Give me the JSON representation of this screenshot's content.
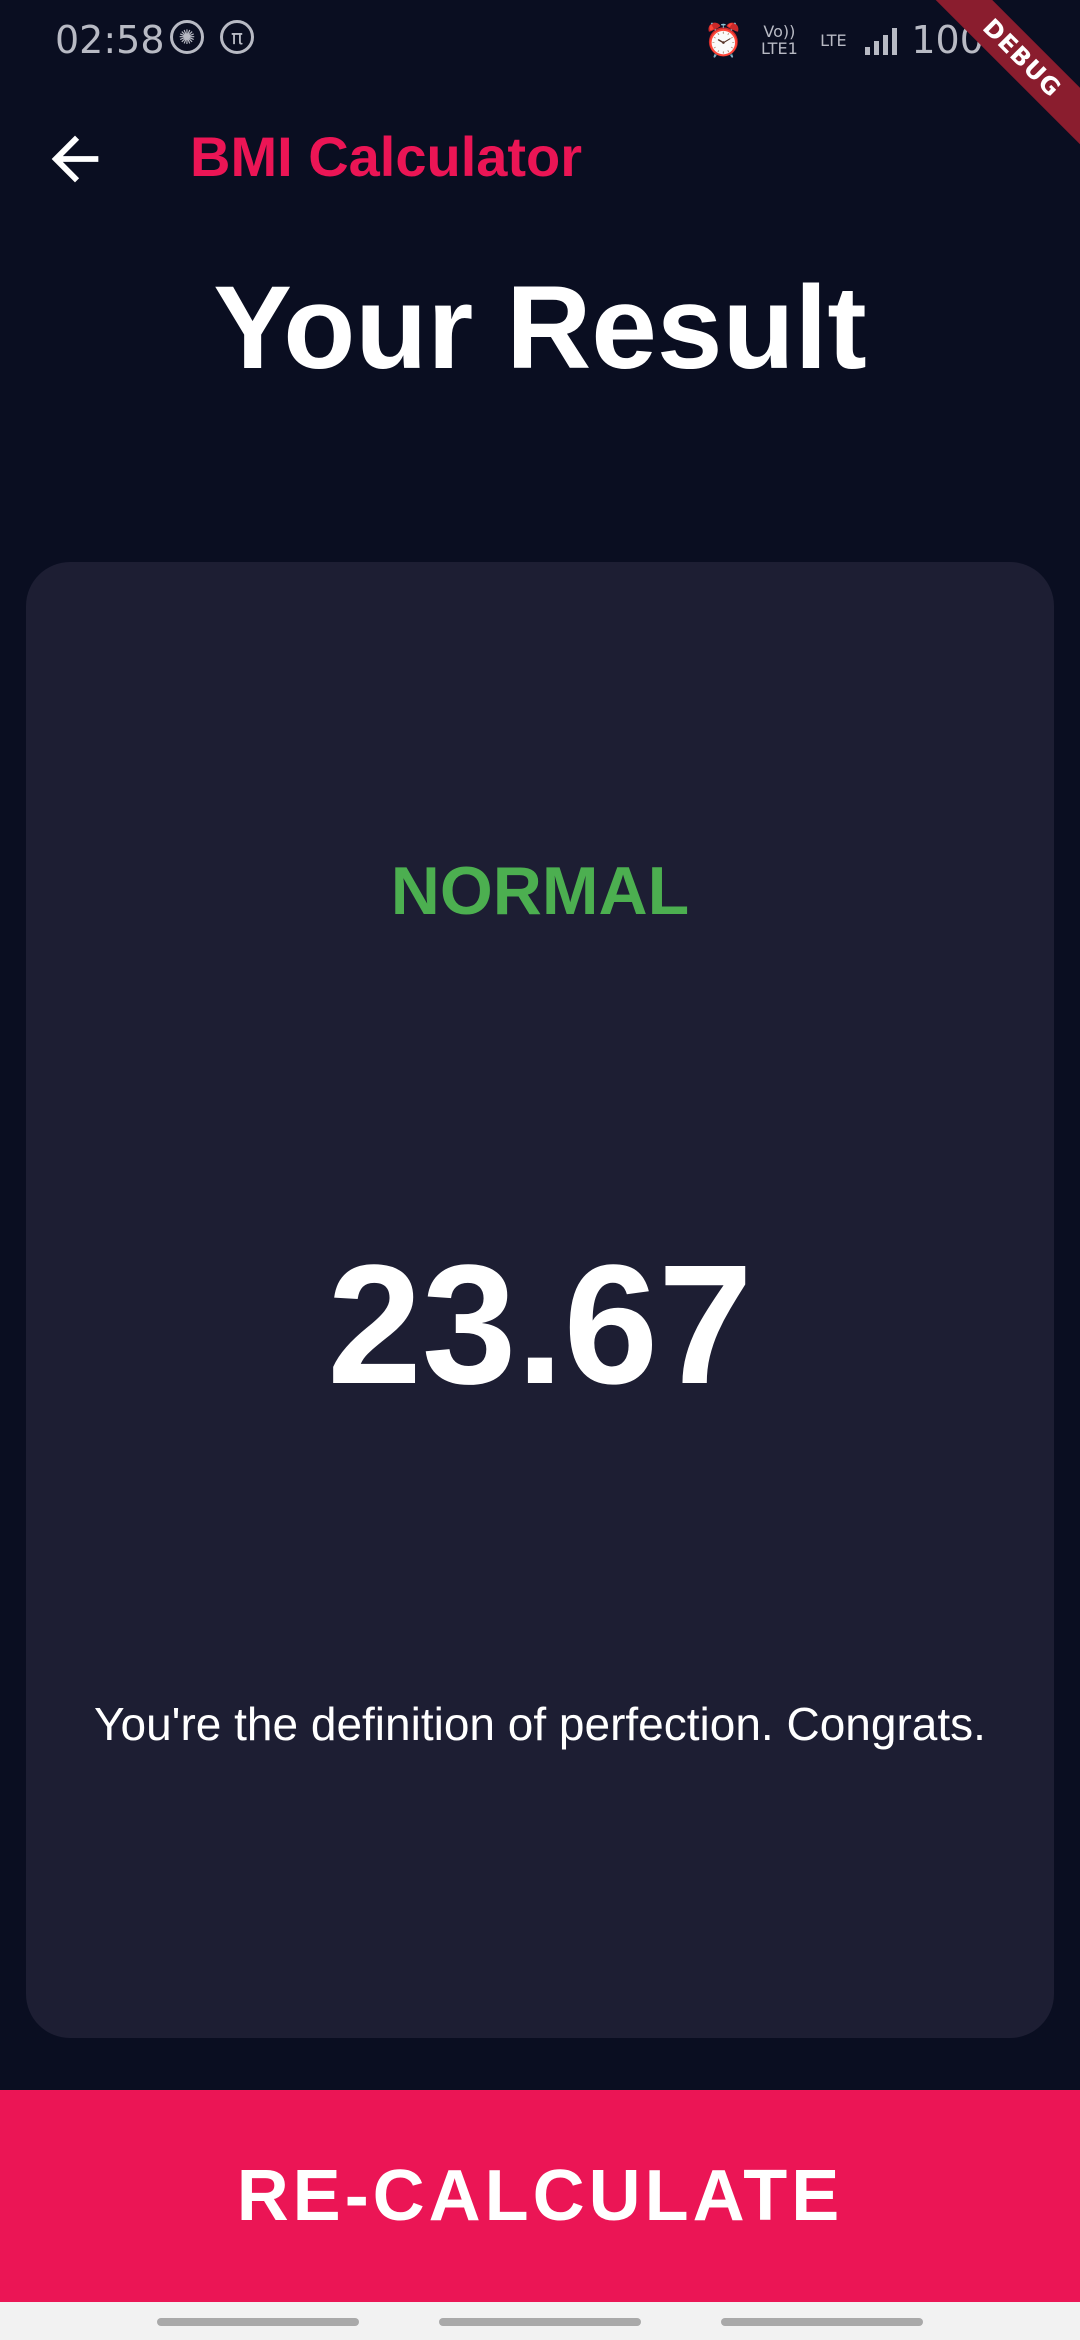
{
  "status_bar": {
    "time": "02:58",
    "icons": [
      "aperture-icon",
      "pi-icon",
      "alarm-icon",
      "volte-icon",
      "lte-icon",
      "signal-icon"
    ],
    "volte_label": "Vo)) LTE1",
    "lte_label": "LTE",
    "battery": "100%",
    "debug_label": "DEBUG"
  },
  "app_bar": {
    "back_icon": "back-arrow-icon",
    "title": "BMI Calculator",
    "title_color": "#eb1555"
  },
  "heading": "Your Result",
  "result": {
    "status": "NORMAL",
    "status_color": "#4caf50",
    "bmi": "23.67",
    "message": "You're the definition of perfection. Congrats."
  },
  "button": {
    "label": "RE-CALCULATE",
    "color": "#eb1555"
  },
  "colors": {
    "background": "#0a0e21",
    "card": "#1d1e33"
  }
}
